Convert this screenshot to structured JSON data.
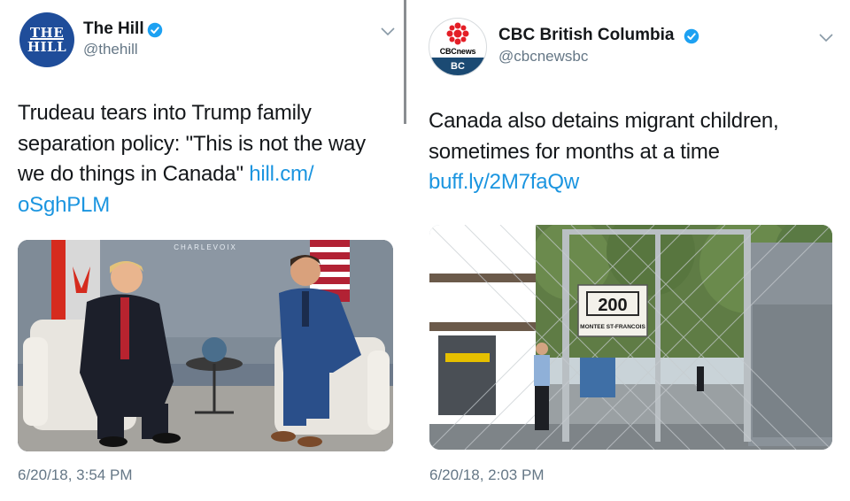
{
  "left_tweet": {
    "display_name": "The Hill",
    "handle": "@thehill",
    "avatar": {
      "line1": "THE",
      "line2": "HILL"
    },
    "text": "Trudeau tears into Trump family separation policy: \"This is not the way we do things in Canada\" ",
    "link": "hill.cm/\noSghPLM",
    "link_line1": "hill.cm/",
    "link_line2": "oSghPLM",
    "text_line1": "Trudeau tears into Trump family",
    "text_line2": "separation policy: \"This is not the way",
    "text_line3": "we do things in Canada\"",
    "photo_sign": "CHARLEVOIX",
    "timestamp": "6/20/18, 3:54 PM",
    "icons": {
      "verified": "verified-badge-icon",
      "menu": "chevron-down-icon"
    }
  },
  "right_tweet": {
    "display_name": "CBC British Columbia",
    "handle": "@cbcnewsbc",
    "avatar": {
      "brand": "CBCnews",
      "region": "BC"
    },
    "text_line1": "Canada also detains migrant children,",
    "text_line2": "sometimes for months at a time",
    "link": "buff.ly/2M7faQw",
    "photo_sign_number": "200",
    "photo_sign_text": "MONTEE ST-FRANCOIS",
    "timestamp": "6/20/18, 2:03 PM",
    "icons": {
      "verified": "verified-badge-icon",
      "menu": "chevron-down-icon"
    }
  },
  "colors": {
    "link": "#1b95e0",
    "verified": "#1da1f2",
    "hill_blue": "#1f4d9a",
    "cbc_red": "#e41e26",
    "cbc_navy": "#1b4a73",
    "secondary_text": "#657786"
  }
}
